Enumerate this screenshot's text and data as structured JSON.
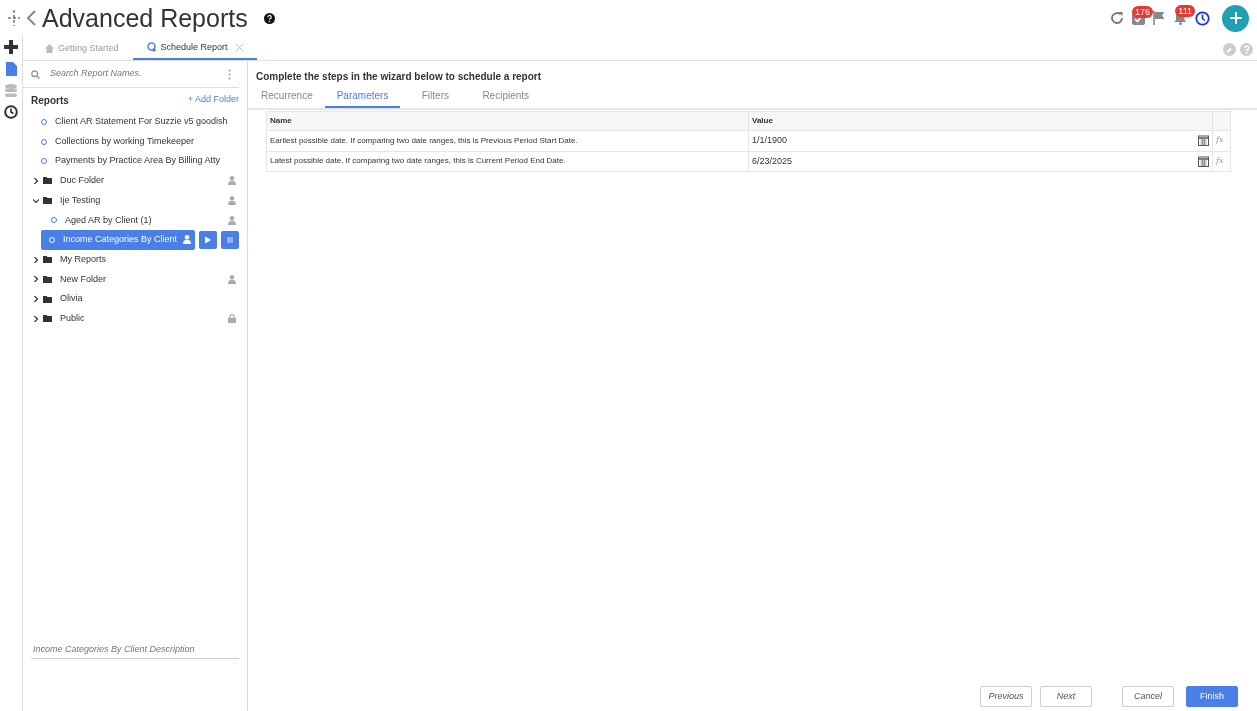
{
  "header": {
    "title": "Advanced Reports",
    "tasks_count": "176",
    "notifications_count": "111"
  },
  "tabs": [
    {
      "label": "Getting Started",
      "selected": false,
      "closable": false
    },
    {
      "label": "Schedule Report",
      "selected": true,
      "closable": true
    }
  ],
  "sidebar": {
    "search_placeholder": "Search Report Names.",
    "heading": "Reports",
    "add_folder": "+ Add Folder",
    "items": [
      {
        "kind": "report",
        "label": "Client AR Statement For Suzzie v5 goodish",
        "selected": false
      },
      {
        "kind": "report",
        "label": "Collections by working Timekeeper",
        "selected": false
      },
      {
        "kind": "report",
        "label": "Payments by Practice Area By Billing Atty",
        "selected": false
      },
      {
        "kind": "folder",
        "label": "Duc Folder",
        "expanded": false,
        "shared": true,
        "selected": false
      },
      {
        "kind": "folder",
        "label": "Ije Testing",
        "expanded": true,
        "shared": true,
        "selected": false,
        "children": [
          {
            "kind": "report",
            "label": "Aged AR by Client (1)",
            "shared": true,
            "selected": false
          },
          {
            "kind": "report",
            "label": "Income Categories By Client",
            "shared": true,
            "selected": true
          }
        ]
      },
      {
        "kind": "folder",
        "label": "My Reports",
        "expanded": false,
        "selected": false
      },
      {
        "kind": "folder",
        "label": "New Folder",
        "expanded": false,
        "shared": true,
        "selected": false
      },
      {
        "kind": "folder",
        "label": "Olivia",
        "expanded": false,
        "selected": false
      },
      {
        "kind": "folder",
        "label": "Public",
        "expanded": false,
        "locked": true,
        "selected": false
      }
    ],
    "description_placeholder": "Income Categories By Client Description"
  },
  "main": {
    "instruction": "Complete the steps in the wizard below to schedule a report",
    "wizard_tabs": [
      {
        "label": "Recurrence",
        "selected": false
      },
      {
        "label": "Parameters",
        "selected": true
      },
      {
        "label": "Filters",
        "selected": false
      },
      {
        "label": "Recipients",
        "selected": false
      }
    ],
    "columns": [
      "Name",
      "Value"
    ],
    "rows": [
      {
        "name": "Earliest possible date. If comparing two date ranges, this is Previous Period Start Date.",
        "value": "1/1/1900",
        "formula": "fx"
      },
      {
        "name": "Latest possible date. If comparing two date ranges, this is Current Period End Date.",
        "value": "6/23/2025",
        "formula": "fx"
      }
    ],
    "buttons": [
      {
        "label": "Previous",
        "kind": "secondary"
      },
      {
        "label": "Next",
        "kind": "secondary"
      },
      {
        "label": "Cancel",
        "kind": "secondary"
      },
      {
        "label": "Finish",
        "kind": "primary"
      }
    ]
  }
}
